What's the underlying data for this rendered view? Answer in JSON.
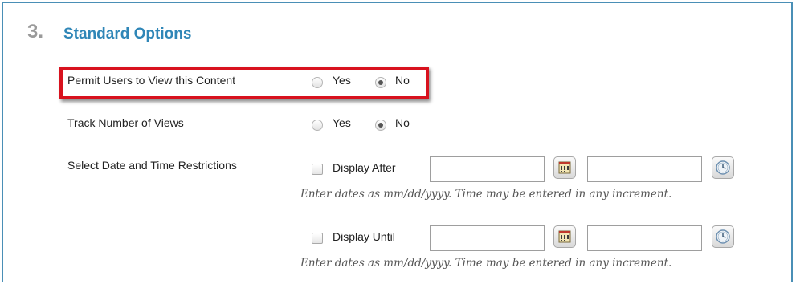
{
  "section": {
    "number": "3.",
    "title": "Standard Options"
  },
  "permit_users": {
    "label": "Permit Users to View this Content",
    "yes_label": "Yes",
    "no_label": "No",
    "selected": "No"
  },
  "track_views": {
    "label": "Track Number of Views",
    "yes_label": "Yes",
    "no_label": "No",
    "selected": "No"
  },
  "restrictions": {
    "label": "Select Date and Time Restrictions",
    "display_after": {
      "label": "Display After",
      "checked": false,
      "date_value": "",
      "time_value": "",
      "hint": "Enter dates as mm/dd/yyyy. Time may be entered in any increment."
    },
    "display_until": {
      "label": "Display Until",
      "checked": false,
      "date_value": "",
      "time_value": "",
      "hint": "Enter dates as mm/dd/yyyy. Time may be entered in any increment."
    }
  },
  "icons": {
    "calendar": "calendar-icon",
    "clock": "clock-icon"
  },
  "colors": {
    "section_title": "#2f86b7",
    "section_number": "#9a9a9a",
    "frame_border": "#4a8fb6",
    "highlight_border": "#d8121e",
    "hint_text": "#555555"
  }
}
